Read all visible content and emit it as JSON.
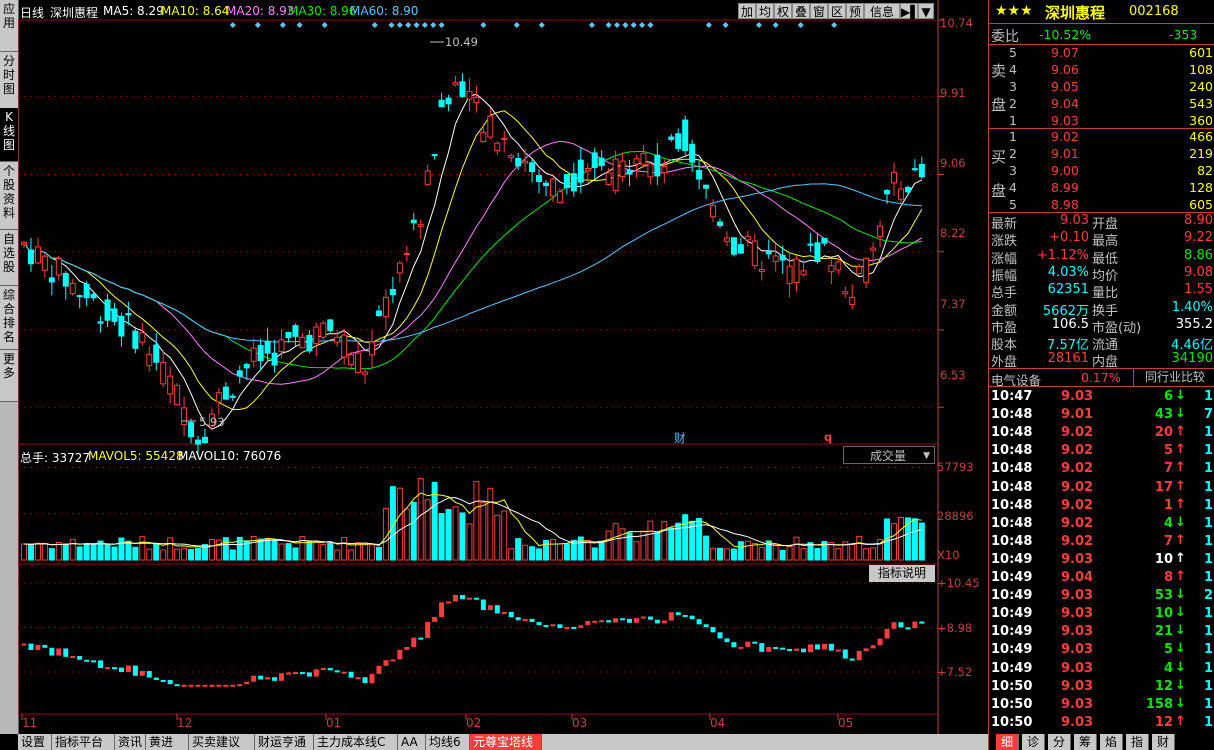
{
  "left_tabs": [
    {
      "label": "应用",
      "active": false
    },
    {
      "label": "分时图",
      "active": false
    },
    {
      "label": "K线图",
      "active": true
    },
    {
      "label": "个股资料",
      "active": false
    },
    {
      "label": "自选股",
      "active": false
    },
    {
      "label": "综合排名",
      "active": false
    },
    {
      "label": "更多",
      "active": false
    }
  ],
  "header": {
    "period": "日线",
    "stock": "深圳惠程",
    "ma5": "MA5: 8.29",
    "ma10": "MA10: 8.64",
    "ma20": "MA20: 8.93",
    "ma30": "MA30: 8.96",
    "ma60": "MA60: 8.90"
  },
  "toolbar": [
    "加",
    "均",
    "权",
    "叠",
    "窗",
    "区",
    "预",
    "信息"
  ],
  "price_axis": [
    "10.74",
    "9.91",
    "9.06",
    "8.22",
    "7.37",
    "6.53"
  ],
  "annotations": {
    "high": "10.49",
    "low": "5.93",
    "fin": "财",
    "q": "q"
  },
  "volume": {
    "title": "总手: 33727",
    "mavol5": "MAVOL5: 55428",
    "mavol10": "MAVOL10: 76076",
    "selector": "成交量",
    "axis": [
      "57793",
      "28896",
      "X10"
    ]
  },
  "indicator": {
    "button": "指标说明",
    "axis": [
      "+10.45",
      "+8.98",
      "+7.52"
    ]
  },
  "x_axis": [
    "11",
    "12",
    "01",
    "02",
    "03",
    "04",
    "05"
  ],
  "bottom_tabs": [
    "设置",
    "指标平台",
    "资讯",
    "黄进",
    "买卖建议",
    "财运亨通",
    "主力成本线C",
    "AA",
    "均线6",
    "元尊宝塔线"
  ],
  "bottom_active": 9,
  "quote": {
    "stars": "★★★",
    "name": "深圳惠程",
    "code": "002168",
    "webi_label": "委比",
    "webi": "-10.52%",
    "webi_diff": "-353",
    "sell_label": [
      "卖",
      "盘"
    ],
    "buy_label": [
      "买",
      "盘"
    ],
    "sells": [
      [
        "5",
        "9.07",
        "601"
      ],
      [
        "4",
        "9.06",
        "108"
      ],
      [
        "3",
        "9.05",
        "240"
      ],
      [
        "2",
        "9.04",
        "543"
      ],
      [
        "1",
        "9.03",
        "360"
      ]
    ],
    "buys": [
      [
        "1",
        "9.02",
        "466"
      ],
      [
        "2",
        "9.01",
        "219"
      ],
      [
        "3",
        "9.00",
        "82"
      ],
      [
        "4",
        "8.99",
        "128"
      ],
      [
        "5",
        "8.98",
        "605"
      ]
    ],
    "stats": [
      [
        "最新",
        "9.03",
        "开盘",
        "8.90"
      ],
      [
        "涨跌",
        "+0.10",
        "最高",
        "9.22"
      ],
      [
        "涨幅",
        "+1.12%",
        "最低",
        "8.86"
      ],
      [
        "振幅",
        "4.03%",
        "均价",
        "9.08"
      ],
      [
        "总手",
        "62351",
        "量比",
        "1.55"
      ],
      [
        "金额",
        "5662万",
        "换手",
        "1.40%"
      ],
      [
        "市盈",
        "106.5",
        "市盈(动)",
        "355.2"
      ],
      [
        "股本",
        "7.57亿",
        "流通",
        "4.46亿"
      ],
      [
        "外盘",
        "28161",
        "内盘",
        "34190"
      ]
    ],
    "industry": "电气设备",
    "industry_pct": "0.17%",
    "compare": "同行业比较",
    "ticks": [
      [
        "10:47",
        "9.03",
        "6",
        "dn",
        "1"
      ],
      [
        "10:48",
        "9.01",
        "43",
        "dn",
        "7"
      ],
      [
        "10:48",
        "9.02",
        "20",
        "up",
        "1"
      ],
      [
        "10:48",
        "9.02",
        "5",
        "up",
        "1"
      ],
      [
        "10:48",
        "9.02",
        "7",
        "up",
        "1"
      ],
      [
        "10:48",
        "9.02",
        "17",
        "up",
        "1"
      ],
      [
        "10:48",
        "9.02",
        "1",
        "up",
        "1"
      ],
      [
        "10:48",
        "9.02",
        "4",
        "dn",
        "1"
      ],
      [
        "10:48",
        "9.02",
        "7",
        "up",
        "1"
      ],
      [
        "10:49",
        "9.03",
        "10",
        "wt",
        "1"
      ],
      [
        "10:49",
        "9.04",
        "8",
        "up",
        "1"
      ],
      [
        "10:49",
        "9.03",
        "53",
        "dn",
        "2"
      ],
      [
        "10:49",
        "9.03",
        "10",
        "dn",
        "1"
      ],
      [
        "10:49",
        "9.03",
        "21",
        "dn",
        "1"
      ],
      [
        "10:49",
        "9.03",
        "5",
        "dn",
        "1"
      ],
      [
        "10:49",
        "9.03",
        "4",
        "dn",
        "1"
      ],
      [
        "10:50",
        "9.03",
        "12",
        "dn",
        "1"
      ],
      [
        "10:50",
        "9.03",
        "158",
        "dn",
        "1"
      ],
      [
        "10:50",
        "9.03",
        "12",
        "up",
        "1"
      ]
    ],
    "right_tabs": [
      "细",
      "诊",
      "分",
      "筹",
      "焰",
      "指",
      "财"
    ]
  },
  "colors": {
    "up": "#ff3c3c",
    "down": "#00ffff",
    "grid": "#7a0000",
    "ma5": "#ffffff",
    "ma10": "#ffff00",
    "ma20": "#ff80ff",
    "ma30": "#00e600",
    "ma60": "#54c8ff"
  },
  "chart_data": {
    "type": "candlestick",
    "x": [
      "11",
      "12",
      "01",
      "02",
      "03",
      "04",
      "05"
    ],
    "ylim": [
      6.13,
      10.74
    ],
    "labels": {
      "high": 10.49,
      "low": 5.93
    },
    "price_levels": [
      10.74,
      9.91,
      9.06,
      8.22,
      7.37,
      6.53
    ],
    "volume_levels": [
      57793,
      28896
    ],
    "indicator_levels": [
      10.45,
      8.98,
      7.52
    ]
  }
}
